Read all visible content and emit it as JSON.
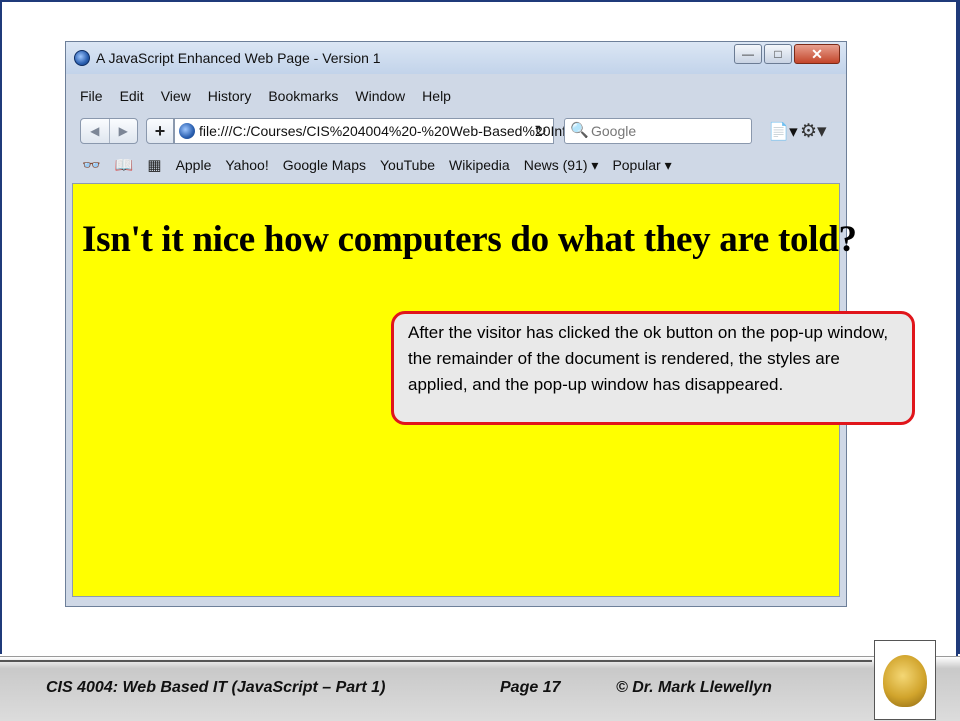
{
  "window": {
    "title": "A JavaScript Enhanced Web Page - Version 1",
    "minimize_glyph": "—",
    "maximize_glyph": "□",
    "close_glyph": "✕"
  },
  "menu": {
    "items": [
      "File",
      "Edit",
      "View",
      "History",
      "Bookmarks",
      "Window",
      "Help"
    ]
  },
  "navigation": {
    "back_glyph": "◀",
    "forward_glyph": "▶",
    "add_glyph": "+",
    "url": "file:///C:/Courses/CIS%204004%20-%20Web-Based%20Info",
    "reload_glyph": "↻",
    "search_placeholder": "Google",
    "search_glyph": "🔍",
    "page_glyph": "📄▾",
    "gear_glyph": "⚙▾"
  },
  "bookmarks": {
    "reader_glyph": "👓",
    "book_glyph": "📖",
    "grid_glyph": "▦",
    "items": [
      "Apple",
      "Yahoo!",
      "Google Maps",
      "YouTube",
      "Wikipedia",
      "News (91) ▾",
      "Popular ▾"
    ]
  },
  "page": {
    "background_color": "#ffff00",
    "headline": "Isn't it nice how computers do what they are told?"
  },
  "callout": {
    "text": "After the visitor has clicked the ok button on the pop-up window, the remainder of the document is rendered, the styles are applied, and the pop-up window has disappeared.",
    "border_color": "#e0151b"
  },
  "footer": {
    "course": "CIS 4004: Web Based IT (JavaScript – Part 1)",
    "page": "Page 17",
    "author": "© Dr. Mark Llewellyn"
  },
  "colors": {
    "slide_border": "#1f3a7a",
    "logo_gold": "#d1a42c"
  }
}
